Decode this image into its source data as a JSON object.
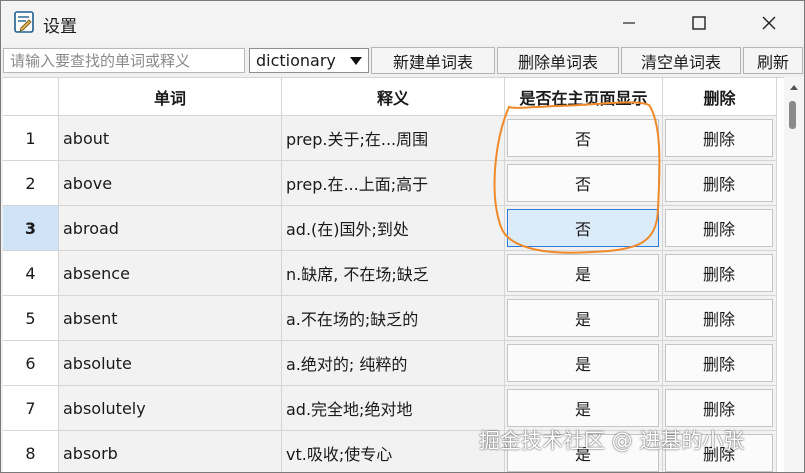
{
  "window": {
    "title": "设置"
  },
  "toolbar": {
    "search_placeholder": "请输入要查找的单词或释义",
    "dictionary_value": "dictionary",
    "new_label": "新建单词表",
    "delete_label": "删除单词表",
    "clear_label": "清空单词表",
    "refresh_label": "刷新"
  },
  "table": {
    "headers": {
      "word": "单词",
      "meaning": "释义",
      "show": "是否在主页面显示",
      "delete": "删除"
    },
    "selected_row": 3,
    "rows": [
      {
        "num": "1",
        "word": "about",
        "meaning": "prep.关于;在...周围",
        "show": "否",
        "delete": "删除"
      },
      {
        "num": "2",
        "word": "above",
        "meaning": "prep.在...上面;高于",
        "show": "否",
        "delete": "删除"
      },
      {
        "num": "3",
        "word": "abroad",
        "meaning": "ad.(在)国外;到处",
        "show": "否",
        "delete": "删除"
      },
      {
        "num": "4",
        "word": "absence",
        "meaning": "n.缺席, 不在场;缺乏",
        "show": "是",
        "delete": "删除"
      },
      {
        "num": "5",
        "word": "absent",
        "meaning": "a.不在场的;缺乏的",
        "show": "是",
        "delete": "删除"
      },
      {
        "num": "6",
        "word": "absolute",
        "meaning": "a.绝对的; 纯粹的",
        "show": "是",
        "delete": "删除"
      },
      {
        "num": "7",
        "word": "absolutely",
        "meaning": "ad.完全地;绝对地",
        "show": "是",
        "delete": "删除"
      },
      {
        "num": "8",
        "word": "absorb",
        "meaning": "vt.吸收;使专心",
        "show": "是",
        "delete": "删除"
      }
    ]
  },
  "watermark": "掘金技术社区 @ 进基的小张",
  "colors": {
    "selected_row_bg": "#cfe4f7",
    "active_button_border": "#2f7ad9",
    "annotation_stroke": "#f08a2a"
  },
  "icons": {
    "app": "settings-app-icon",
    "minimize": "minimize-icon",
    "maximize": "maximize-icon",
    "close": "close-icon",
    "dropdown": "dropdown-arrow-icon"
  }
}
